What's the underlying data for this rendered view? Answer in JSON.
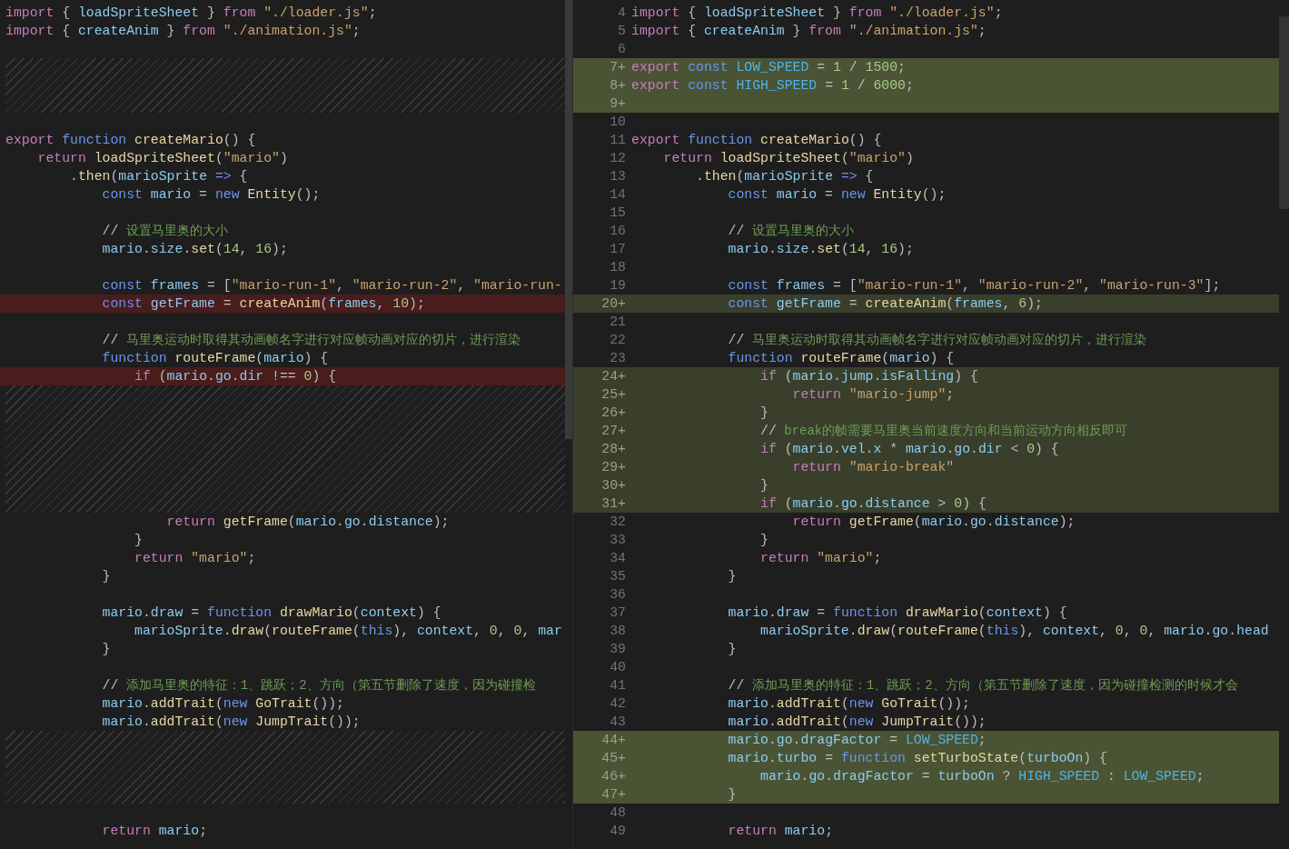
{
  "left": {
    "rows": [
      {
        "kind": "line",
        "tokens": [
          {
            "kind": "key",
            "text": "import"
          },
          {
            "kind": "punct",
            "text": " { "
          },
          {
            "kind": "var",
            "text": "loadSpriteSheet"
          },
          {
            "kind": "punct",
            "text": " } "
          },
          {
            "kind": "key",
            "text": "from"
          },
          {
            "kind": "str",
            "text": " \"./loader.js\""
          },
          {
            "kind": "punct",
            "text": ";"
          }
        ]
      },
      {
        "kind": "line",
        "tokens": [
          {
            "kind": "key",
            "text": "import"
          },
          {
            "kind": "punct",
            "text": " { "
          },
          {
            "kind": "var",
            "text": "createAnim"
          },
          {
            "kind": "punct",
            "text": " } "
          },
          {
            "kind": "key",
            "text": "from"
          },
          {
            "kind": "str",
            "text": " \"./animation.js\""
          },
          {
            "kind": "punct",
            "text": ";"
          }
        ]
      },
      {
        "kind": "blank"
      },
      {
        "kind": "filler"
      },
      {
        "kind": "filler"
      },
      {
        "kind": "filler"
      },
      {
        "kind": "blank"
      },
      {
        "kind": "line",
        "tokens": [
          {
            "kind": "key",
            "text": "export"
          },
          {
            "kind": "decl",
            "text": " function"
          },
          {
            "kind": "fn",
            "text": " createMario"
          },
          {
            "kind": "punct",
            "text": "() {"
          }
        ]
      },
      {
        "kind": "line",
        "tokens": [
          {
            "kind": "key",
            "text": "    return"
          },
          {
            "kind": "fn",
            "text": " loadSpriteSheet"
          },
          {
            "kind": "punct",
            "text": "("
          },
          {
            "kind": "str",
            "text": "\"mario\""
          },
          {
            "kind": "punct",
            "text": ")"
          }
        ]
      },
      {
        "kind": "line",
        "tokens": [
          {
            "kind": "punct",
            "text": "        ."
          },
          {
            "kind": "fn",
            "text": "then"
          },
          {
            "kind": "punct",
            "text": "("
          },
          {
            "kind": "var",
            "text": "marioSprite"
          },
          {
            "kind": "decl",
            "text": " =>"
          },
          {
            "kind": "punct",
            "text": " {"
          }
        ]
      },
      {
        "kind": "line",
        "tokens": [
          {
            "kind": "decl",
            "text": "            const"
          },
          {
            "kind": "var",
            "text": " mario"
          },
          {
            "kind": "punct",
            "text": " = "
          },
          {
            "kind": "decl",
            "text": "new"
          },
          {
            "kind": "fn",
            "text": " Entity"
          },
          {
            "kind": "punct",
            "text": "();"
          }
        ]
      },
      {
        "kind": "blank"
      },
      {
        "kind": "line",
        "tokens": [
          {
            "kind": "punct",
            "text": "            //"
          },
          {
            "kind": "note",
            "text": " 设置马里奥的大小"
          }
        ]
      },
      {
        "kind": "line",
        "tokens": [
          {
            "kind": "var",
            "text": "            mario"
          },
          {
            "kind": "punct",
            "text": "."
          },
          {
            "kind": "var",
            "text": "size"
          },
          {
            "kind": "punct",
            "text": "."
          },
          {
            "kind": "fn",
            "text": "set"
          },
          {
            "kind": "punct",
            "text": "("
          },
          {
            "kind": "num",
            "text": "14"
          },
          {
            "kind": "punct",
            "text": ", "
          },
          {
            "kind": "num",
            "text": "16"
          },
          {
            "kind": "punct",
            "text": ");"
          }
        ]
      },
      {
        "kind": "blank"
      },
      {
        "kind": "line",
        "tokens": [
          {
            "kind": "decl",
            "text": "            const"
          },
          {
            "kind": "var",
            "text": " frames"
          },
          {
            "kind": "punct",
            "text": " = ["
          },
          {
            "kind": "str",
            "text": "\"mario-run-1\""
          },
          {
            "kind": "punct",
            "text": ", "
          },
          {
            "kind": "str",
            "text": "\"mario-run-2\""
          },
          {
            "kind": "punct",
            "text": ", "
          },
          {
            "kind": "str",
            "text": "\"mario-run-"
          }
        ]
      },
      {
        "kind": "changed",
        "tokens": [
          {
            "kind": "decl",
            "text": "            const"
          },
          {
            "kind": "var",
            "text": " getFrame"
          },
          {
            "kind": "punct",
            "text": " = "
          },
          {
            "kind": "fn",
            "text": "createAnim"
          },
          {
            "kind": "punct",
            "text": "("
          },
          {
            "kind": "var",
            "text": "frames"
          },
          {
            "kind": "punct",
            "text": ", "
          },
          {
            "kind": "num",
            "text": "10"
          },
          {
            "kind": "punct",
            "text": ");"
          }
        ]
      },
      {
        "kind": "blank"
      },
      {
        "kind": "line",
        "tokens": [
          {
            "kind": "punct",
            "text": "            //"
          },
          {
            "kind": "note",
            "text": " 马里奥运动时取得其动画帧名字进行对应帧动画对应的切片，进行渲染"
          }
        ]
      },
      {
        "kind": "line",
        "tokens": [
          {
            "kind": "decl",
            "text": "            function"
          },
          {
            "kind": "fn",
            "text": " routeFrame"
          },
          {
            "kind": "punct",
            "text": "("
          },
          {
            "kind": "var",
            "text": "mario"
          },
          {
            "kind": "punct",
            "text": ") {"
          }
        ]
      },
      {
        "kind": "changed",
        "tokens": [
          {
            "kind": "key",
            "text": "                if"
          },
          {
            "kind": "punct",
            "text": " ("
          },
          {
            "kind": "var",
            "text": "mario"
          },
          {
            "kind": "punct",
            "text": "."
          },
          {
            "kind": "var",
            "text": "go"
          },
          {
            "kind": "punct",
            "text": "."
          },
          {
            "kind": "var",
            "text": "dir"
          },
          {
            "kind": "punct",
            "text": " !== "
          },
          {
            "kind": "num",
            "text": "0"
          },
          {
            "kind": "punct",
            "text": ") {"
          }
        ]
      },
      {
        "kind": "filler"
      },
      {
        "kind": "filler"
      },
      {
        "kind": "filler"
      },
      {
        "kind": "filler"
      },
      {
        "kind": "filler"
      },
      {
        "kind": "filler"
      },
      {
        "kind": "filler"
      },
      {
        "kind": "line",
        "tokens": [
          {
            "kind": "key",
            "text": "                    return"
          },
          {
            "kind": "fn",
            "text": " getFrame"
          },
          {
            "kind": "punct",
            "text": "("
          },
          {
            "kind": "var",
            "text": "mario"
          },
          {
            "kind": "punct",
            "text": "."
          },
          {
            "kind": "var",
            "text": "go"
          },
          {
            "kind": "punct",
            "text": "."
          },
          {
            "kind": "var",
            "text": "distance"
          },
          {
            "kind": "punct",
            "text": ");"
          }
        ]
      },
      {
        "kind": "line",
        "tokens": [
          {
            "kind": "punct",
            "text": "                }"
          }
        ]
      },
      {
        "kind": "line",
        "tokens": [
          {
            "kind": "key",
            "text": "                return"
          },
          {
            "kind": "str",
            "text": " \"mario\""
          },
          {
            "kind": "punct",
            "text": ";"
          }
        ]
      },
      {
        "kind": "line",
        "tokens": [
          {
            "kind": "punct",
            "text": "            }"
          }
        ]
      },
      {
        "kind": "blank"
      },
      {
        "kind": "line",
        "tokens": [
          {
            "kind": "var",
            "text": "            mario"
          },
          {
            "kind": "punct",
            "text": "."
          },
          {
            "kind": "var",
            "text": "draw"
          },
          {
            "kind": "punct",
            "text": " = "
          },
          {
            "kind": "decl",
            "text": "function"
          },
          {
            "kind": "fn",
            "text": " drawMario"
          },
          {
            "kind": "punct",
            "text": "("
          },
          {
            "kind": "var",
            "text": "context"
          },
          {
            "kind": "punct",
            "text": ") {"
          }
        ]
      },
      {
        "kind": "line",
        "tokens": [
          {
            "kind": "var",
            "text": "                marioSprite"
          },
          {
            "kind": "punct",
            "text": "."
          },
          {
            "kind": "fn",
            "text": "draw"
          },
          {
            "kind": "punct",
            "text": "("
          },
          {
            "kind": "fn",
            "text": "routeFrame"
          },
          {
            "kind": "punct",
            "text": "("
          },
          {
            "kind": "decl",
            "text": "this"
          },
          {
            "kind": "punct",
            "text": "), "
          },
          {
            "kind": "var",
            "text": "context"
          },
          {
            "kind": "punct",
            "text": ", "
          },
          {
            "kind": "num",
            "text": "0"
          },
          {
            "kind": "punct",
            "text": ", "
          },
          {
            "kind": "num",
            "text": "0"
          },
          {
            "kind": "punct",
            "text": ", "
          },
          {
            "kind": "var",
            "text": "mar"
          }
        ]
      },
      {
        "kind": "line",
        "tokens": [
          {
            "kind": "punct",
            "text": "            }"
          }
        ]
      },
      {
        "kind": "blank"
      },
      {
        "kind": "line",
        "tokens": [
          {
            "kind": "punct",
            "text": "            //"
          },
          {
            "kind": "note",
            "text": " 添加马里奥的特征：1、跳跃；2、方向（第五节删除了速度，因为碰撞检"
          }
        ]
      },
      {
        "kind": "line",
        "tokens": [
          {
            "kind": "var",
            "text": "            mario"
          },
          {
            "kind": "punct",
            "text": "."
          },
          {
            "kind": "fn",
            "text": "addTrait"
          },
          {
            "kind": "punct",
            "text": "("
          },
          {
            "kind": "decl",
            "text": "new"
          },
          {
            "kind": "fn",
            "text": " GoTrait"
          },
          {
            "kind": "punct",
            "text": "());"
          }
        ]
      },
      {
        "kind": "line",
        "tokens": [
          {
            "kind": "var",
            "text": "            mario"
          },
          {
            "kind": "punct",
            "text": "."
          },
          {
            "kind": "fn",
            "text": "addTrait"
          },
          {
            "kind": "punct",
            "text": "("
          },
          {
            "kind": "decl",
            "text": "new"
          },
          {
            "kind": "fn",
            "text": " JumpTrait"
          },
          {
            "kind": "punct",
            "text": "());"
          }
        ]
      },
      {
        "kind": "filler"
      },
      {
        "kind": "filler"
      },
      {
        "kind": "filler"
      },
      {
        "kind": "filler"
      },
      {
        "kind": "blank"
      },
      {
        "kind": "line",
        "tokens": [
          {
            "kind": "key",
            "text": "            return"
          },
          {
            "kind": "var",
            "text": " mario"
          },
          {
            "kind": "punct",
            "text": ";"
          }
        ]
      }
    ]
  },
  "right": {
    "rows": [
      {
        "number": "4",
        "kind": "unchanged",
        "tokens": [
          {
            "kind": "key",
            "text": "import"
          },
          {
            "kind": "punct",
            "text": " { "
          },
          {
            "kind": "var",
            "text": "loadSpriteSheet"
          },
          {
            "kind": "punct",
            "text": " } "
          },
          {
            "kind": "key",
            "text": "from"
          },
          {
            "kind": "str",
            "text": " \"./loader.js\""
          },
          {
            "kind": "punct",
            "text": ";"
          }
        ]
      },
      {
        "number": "5",
        "kind": "unchanged",
        "tokens": [
          {
            "kind": "key",
            "text": "import"
          },
          {
            "kind": "punct",
            "text": " { "
          },
          {
            "kind": "var",
            "text": "createAnim"
          },
          {
            "kind": "punct",
            "text": " } "
          },
          {
            "kind": "key",
            "text": "from"
          },
          {
            "kind": "str",
            "text": " \"./animation.js\""
          },
          {
            "kind": "punct",
            "text": ";"
          }
        ]
      },
      {
        "number": "6",
        "kind": "unchanged"
      },
      {
        "number": "7+",
        "kind": "added",
        "tokens": [
          {
            "kind": "key",
            "text": "export"
          },
          {
            "kind": "decl",
            "text": " const"
          },
          {
            "kind": "const",
            "text": " LOW_SPEED"
          },
          {
            "kind": "punct",
            "text": " = "
          },
          {
            "kind": "num",
            "text": "1"
          },
          {
            "kind": "punct",
            "text": " / "
          },
          {
            "kind": "num",
            "text": "1500"
          },
          {
            "kind": "punct",
            "text": ";"
          }
        ]
      },
      {
        "number": "8+",
        "kind": "added",
        "tokens": [
          {
            "kind": "key",
            "text": "export"
          },
          {
            "kind": "decl",
            "text": " const"
          },
          {
            "kind": "const",
            "text": " HIGH_SPEED"
          },
          {
            "kind": "punct",
            "text": " = "
          },
          {
            "kind": "num",
            "text": "1"
          },
          {
            "kind": "punct",
            "text": " / "
          },
          {
            "kind": "num",
            "text": "6000"
          },
          {
            "kind": "punct",
            "text": ";"
          }
        ]
      },
      {
        "number": "9+",
        "kind": "added"
      },
      {
        "number": "10",
        "kind": "unchanged"
      },
      {
        "number": "11",
        "kind": "unchanged",
        "tokens": [
          {
            "kind": "key",
            "text": "export"
          },
          {
            "kind": "decl",
            "text": " function"
          },
          {
            "kind": "fn",
            "text": " createMario"
          },
          {
            "kind": "punct",
            "text": "() {"
          }
        ]
      },
      {
        "number": "12",
        "kind": "unchanged",
        "tokens": [
          {
            "kind": "key",
            "text": "    return"
          },
          {
            "kind": "fn",
            "text": " loadSpriteSheet"
          },
          {
            "kind": "punct",
            "text": "("
          },
          {
            "kind": "str",
            "text": "\"mario\""
          },
          {
            "kind": "punct",
            "text": ")"
          }
        ]
      },
      {
        "number": "13",
        "kind": "unchanged",
        "tokens": [
          {
            "kind": "punct",
            "text": "        ."
          },
          {
            "kind": "fn",
            "text": "then"
          },
          {
            "kind": "punct",
            "text": "("
          },
          {
            "kind": "var",
            "text": "marioSprite"
          },
          {
            "kind": "decl",
            "text": " =>"
          },
          {
            "kind": "punct",
            "text": " {"
          }
        ]
      },
      {
        "number": "14",
        "kind": "unchanged",
        "tokens": [
          {
            "kind": "decl",
            "text": "            const"
          },
          {
            "kind": "var",
            "text": " mario"
          },
          {
            "kind": "punct",
            "text": " = "
          },
          {
            "kind": "decl",
            "text": "new"
          },
          {
            "kind": "fn",
            "text": " Entity"
          },
          {
            "kind": "punct",
            "text": "();"
          }
        ]
      },
      {
        "number": "15",
        "kind": "unchanged"
      },
      {
        "number": "16",
        "kind": "unchanged",
        "tokens": [
          {
            "kind": "punct",
            "text": "            //"
          },
          {
            "kind": "note",
            "text": " 设置马里奥的大小"
          }
        ]
      },
      {
        "number": "17",
        "kind": "unchanged",
        "tokens": [
          {
            "kind": "var",
            "text": "            mario"
          },
          {
            "kind": "punct",
            "text": "."
          },
          {
            "kind": "var",
            "text": "size"
          },
          {
            "kind": "punct",
            "text": "."
          },
          {
            "kind": "fn",
            "text": "set"
          },
          {
            "kind": "punct",
            "text": "("
          },
          {
            "kind": "num",
            "text": "14"
          },
          {
            "kind": "punct",
            "text": ", "
          },
          {
            "kind": "num",
            "text": "16"
          },
          {
            "kind": "punct",
            "text": ");"
          }
        ]
      },
      {
        "number": "18",
        "kind": "unchanged"
      },
      {
        "number": "19",
        "kind": "unchanged",
        "tokens": [
          {
            "kind": "decl",
            "text": "            const"
          },
          {
            "kind": "var",
            "text": " frames"
          },
          {
            "kind": "punct",
            "text": " = ["
          },
          {
            "kind": "str",
            "text": "\"mario-run-1\""
          },
          {
            "kind": "punct",
            "text": ", "
          },
          {
            "kind": "str",
            "text": "\"mario-run-2\""
          },
          {
            "kind": "punct",
            "text": ", "
          },
          {
            "kind": "str",
            "text": "\"mario-run-3\""
          },
          {
            "kind": "punct",
            "text": "];"
          }
        ]
      },
      {
        "number": "20+",
        "kind": "modified",
        "tokens": [
          {
            "kind": "decl",
            "text": "            const"
          },
          {
            "kind": "var",
            "text": " getFrame"
          },
          {
            "kind": "punct",
            "text": " = "
          },
          {
            "kind": "fn",
            "text": "createAnim"
          },
          {
            "kind": "punct",
            "text": "("
          },
          {
            "kind": "var",
            "text": "frames"
          },
          {
            "kind": "punct",
            "text": ", "
          },
          {
            "kind": "num",
            "text": "6"
          },
          {
            "kind": "punct",
            "text": ");"
          }
        ]
      },
      {
        "number": "21",
        "kind": "unchanged"
      },
      {
        "number": "22",
        "kind": "unchanged",
        "tokens": [
          {
            "kind": "punct",
            "text": "            //"
          },
          {
            "kind": "note",
            "text": " 马里奥运动时取得其动画帧名字进行对应帧动画对应的切片，进行渲染"
          }
        ]
      },
      {
        "number": "23",
        "kind": "unchanged",
        "tokens": [
          {
            "kind": "decl",
            "text": "            function"
          },
          {
            "kind": "fn",
            "text": " routeFrame"
          },
          {
            "kind": "punct",
            "text": "("
          },
          {
            "kind": "var",
            "text": "mario"
          },
          {
            "kind": "punct",
            "text": ") {"
          }
        ]
      },
      {
        "number": "24+",
        "kind": "modified",
        "tokens": [
          {
            "kind": "key",
            "text": "                if"
          },
          {
            "kind": "punct",
            "text": " ("
          },
          {
            "kind": "var",
            "text": "mario"
          },
          {
            "kind": "punct",
            "text": "."
          },
          {
            "kind": "var",
            "text": "jump"
          },
          {
            "kind": "punct",
            "text": "."
          },
          {
            "kind": "var",
            "text": "isFalling"
          },
          {
            "kind": "punct",
            "text": ") {"
          }
        ]
      },
      {
        "number": "25+",
        "kind": "modified",
        "tokens": [
          {
            "kind": "key",
            "text": "                    return"
          },
          {
            "kind": "str",
            "text": " \"mario-jump\""
          },
          {
            "kind": "punct",
            "text": ";"
          }
        ]
      },
      {
        "number": "26+",
        "kind": "modified",
        "tokens": [
          {
            "kind": "punct",
            "text": "                }"
          }
        ]
      },
      {
        "number": "27+",
        "kind": "modified",
        "tokens": [
          {
            "kind": "punct",
            "text": "                //"
          },
          {
            "kind": "note",
            "text": " break的帧需要马里奥当前速度方向和当前运动方向相反即可"
          }
        ]
      },
      {
        "number": "28+",
        "kind": "modified",
        "tokens": [
          {
            "kind": "key",
            "text": "                if"
          },
          {
            "kind": "punct",
            "text": " ("
          },
          {
            "kind": "var",
            "text": "mario"
          },
          {
            "kind": "punct",
            "text": "."
          },
          {
            "kind": "var",
            "text": "vel"
          },
          {
            "kind": "punct",
            "text": "."
          },
          {
            "kind": "var",
            "text": "x"
          },
          {
            "kind": "punct",
            "text": " * "
          },
          {
            "kind": "var",
            "text": "mario"
          },
          {
            "kind": "punct",
            "text": "."
          },
          {
            "kind": "var",
            "text": "go"
          },
          {
            "kind": "punct",
            "text": "."
          },
          {
            "kind": "var",
            "text": "dir"
          },
          {
            "kind": "punct",
            "text": " < "
          },
          {
            "kind": "num",
            "text": "0"
          },
          {
            "kind": "punct",
            "text": ") {"
          }
        ]
      },
      {
        "number": "29+",
        "kind": "modified",
        "tokens": [
          {
            "kind": "key",
            "text": "                    return"
          },
          {
            "kind": "str",
            "text": " \"mario-break\""
          }
        ]
      },
      {
        "number": "30+",
        "kind": "modified",
        "tokens": [
          {
            "kind": "punct",
            "text": "                }"
          }
        ]
      },
      {
        "number": "31+",
        "kind": "modified",
        "tokens": [
          {
            "kind": "key",
            "text": "                if"
          },
          {
            "kind": "punct",
            "text": " ("
          },
          {
            "kind": "var",
            "text": "mario"
          },
          {
            "kind": "punct",
            "text": "."
          },
          {
            "kind": "var",
            "text": "go"
          },
          {
            "kind": "punct",
            "text": "."
          },
          {
            "kind": "var",
            "text": "distance"
          },
          {
            "kind": "punct",
            "text": " > "
          },
          {
            "kind": "num",
            "text": "0"
          },
          {
            "kind": "punct",
            "text": ") {"
          }
        ]
      },
      {
        "number": "32",
        "kind": "unchanged",
        "tokens": [
          {
            "kind": "key",
            "text": "                    return"
          },
          {
            "kind": "fn",
            "text": " getFrame"
          },
          {
            "kind": "punct",
            "text": "("
          },
          {
            "kind": "var",
            "text": "mario"
          },
          {
            "kind": "punct",
            "text": "."
          },
          {
            "kind": "var",
            "text": "go"
          },
          {
            "kind": "punct",
            "text": "."
          },
          {
            "kind": "var",
            "text": "distance"
          },
          {
            "kind": "punct",
            "text": ");"
          }
        ]
      },
      {
        "number": "33",
        "kind": "unchanged",
        "tokens": [
          {
            "kind": "punct",
            "text": "                }"
          }
        ]
      },
      {
        "number": "34",
        "kind": "unchanged",
        "tokens": [
          {
            "kind": "key",
            "text": "                return"
          },
          {
            "kind": "str",
            "text": " \"mario\""
          },
          {
            "kind": "punct",
            "text": ";"
          }
        ]
      },
      {
        "number": "35",
        "kind": "unchanged",
        "tokens": [
          {
            "kind": "punct",
            "text": "            }"
          }
        ]
      },
      {
        "number": "36",
        "kind": "unchanged"
      },
      {
        "number": "37",
        "kind": "unchanged",
        "tokens": [
          {
            "kind": "var",
            "text": "            mario"
          },
          {
            "kind": "punct",
            "text": "."
          },
          {
            "kind": "var",
            "text": "draw"
          },
          {
            "kind": "punct",
            "text": " = "
          },
          {
            "kind": "decl",
            "text": "function"
          },
          {
            "kind": "fn",
            "text": " drawMario"
          },
          {
            "kind": "punct",
            "text": "("
          },
          {
            "kind": "var",
            "text": "context"
          },
          {
            "kind": "punct",
            "text": ") {"
          }
        ]
      },
      {
        "number": "38",
        "kind": "unchanged",
        "tokens": [
          {
            "kind": "var",
            "text": "                marioSprite"
          },
          {
            "kind": "punct",
            "text": "."
          },
          {
            "kind": "fn",
            "text": "draw"
          },
          {
            "kind": "punct",
            "text": "("
          },
          {
            "kind": "fn",
            "text": "routeFrame"
          },
          {
            "kind": "punct",
            "text": "("
          },
          {
            "kind": "decl",
            "text": "this"
          },
          {
            "kind": "punct",
            "text": "), "
          },
          {
            "kind": "var",
            "text": "context"
          },
          {
            "kind": "punct",
            "text": ", "
          },
          {
            "kind": "num",
            "text": "0"
          },
          {
            "kind": "punct",
            "text": ", "
          },
          {
            "kind": "num",
            "text": "0"
          },
          {
            "kind": "punct",
            "text": ", "
          },
          {
            "kind": "var",
            "text": "mario"
          },
          {
            "kind": "punct",
            "text": "."
          },
          {
            "kind": "var",
            "text": "go"
          },
          {
            "kind": "punct",
            "text": "."
          },
          {
            "kind": "var",
            "text": "head"
          }
        ]
      },
      {
        "number": "39",
        "kind": "unchanged",
        "tokens": [
          {
            "kind": "punct",
            "text": "            }"
          }
        ]
      },
      {
        "number": "40",
        "kind": "unchanged"
      },
      {
        "number": "41",
        "kind": "unchanged",
        "tokens": [
          {
            "kind": "punct",
            "text": "            //"
          },
          {
            "kind": "note",
            "text": " 添加马里奥的特征：1、跳跃；2、方向（第五节删除了速度，因为碰撞检测的时候才会"
          }
        ]
      },
      {
        "number": "42",
        "kind": "unchanged",
        "tokens": [
          {
            "kind": "var",
            "text": "            mario"
          },
          {
            "kind": "punct",
            "text": "."
          },
          {
            "kind": "fn",
            "text": "addTrait"
          },
          {
            "kind": "punct",
            "text": "("
          },
          {
            "kind": "decl",
            "text": "new"
          },
          {
            "kind": "fn",
            "text": " GoTrait"
          },
          {
            "kind": "punct",
            "text": "());"
          }
        ]
      },
      {
        "number": "43",
        "kind": "unchanged",
        "tokens": [
          {
            "kind": "var",
            "text": "            mario"
          },
          {
            "kind": "punct",
            "text": "."
          },
          {
            "kind": "fn",
            "text": "addTrait"
          },
          {
            "kind": "punct",
            "text": "("
          },
          {
            "kind": "decl",
            "text": "new"
          },
          {
            "kind": "fn",
            "text": " JumpTrait"
          },
          {
            "kind": "punct",
            "text": "());"
          }
        ]
      },
      {
        "number": "44+",
        "kind": "added",
        "tokens": [
          {
            "kind": "var",
            "text": "            mario"
          },
          {
            "kind": "punct",
            "text": "."
          },
          {
            "kind": "var",
            "text": "go"
          },
          {
            "kind": "punct",
            "text": "."
          },
          {
            "kind": "var",
            "text": "dragFactor"
          },
          {
            "kind": "punct",
            "text": " = "
          },
          {
            "kind": "const",
            "text": "LOW_SPEED"
          },
          {
            "kind": "punct",
            "text": ";"
          }
        ]
      },
      {
        "number": "45+",
        "kind": "added",
        "tokens": [
          {
            "kind": "var",
            "text": "            mario"
          },
          {
            "kind": "punct",
            "text": "."
          },
          {
            "kind": "var",
            "text": "turbo"
          },
          {
            "kind": "punct",
            "text": " = "
          },
          {
            "kind": "decl",
            "text": "function"
          },
          {
            "kind": "fn",
            "text": " setTurboState"
          },
          {
            "kind": "punct",
            "text": "("
          },
          {
            "kind": "var",
            "text": "turboOn"
          },
          {
            "kind": "punct",
            "text": ") {"
          }
        ]
      },
      {
        "number": "46+",
        "kind": "added",
        "tokens": [
          {
            "kind": "var",
            "text": "                mario"
          },
          {
            "kind": "punct",
            "text": "."
          },
          {
            "kind": "var",
            "text": "go"
          },
          {
            "kind": "punct",
            "text": "."
          },
          {
            "kind": "var",
            "text": "dragFactor"
          },
          {
            "kind": "punct",
            "text": " = "
          },
          {
            "kind": "var",
            "text": "turboOn"
          },
          {
            "kind": "punct",
            "text": " ? "
          },
          {
            "kind": "const",
            "text": "HIGH_SPEED"
          },
          {
            "kind": "punct",
            "text": " : "
          },
          {
            "kind": "const",
            "text": "LOW_SPEED"
          },
          {
            "kind": "punct",
            "text": ";"
          }
        ]
      },
      {
        "number": "47+",
        "kind": "added",
        "tokens": [
          {
            "kind": "punct",
            "text": "            }"
          }
        ]
      },
      {
        "number": "48",
        "kind": "unchanged"
      },
      {
        "number": "49",
        "kind": "unchanged",
        "tokens": [
          {
            "kind": "key",
            "text": "            return"
          },
          {
            "kind": "var",
            "text": " mario"
          },
          {
            "kind": "punct",
            "text": ";"
          }
        ]
      }
    ]
  }
}
